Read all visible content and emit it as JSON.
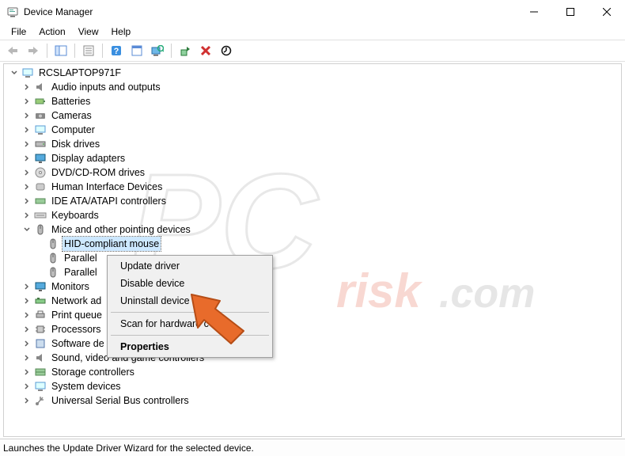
{
  "window": {
    "title": "Device Manager"
  },
  "menus": {
    "file": "File",
    "action": "Action",
    "view": "View",
    "help": "Help"
  },
  "tree": {
    "root": "RCSLAPTOP971F",
    "items": [
      "Audio inputs and outputs",
      "Batteries",
      "Cameras",
      "Computer",
      "Disk drives",
      "Display adapters",
      "DVD/CD-ROM drives",
      "Human Interface Devices",
      "IDE ATA/ATAPI controllers",
      "Keyboards",
      "Mice and other pointing devices",
      "Monitors",
      "Network adapters",
      "Print queues",
      "Processors",
      "Software devices",
      "Sound, video and game controllers",
      "Storage controllers",
      "System devices",
      "Universal Serial Bus controllers"
    ],
    "mice_children": [
      "HID-compliant mouse",
      "Parallels Mouse Synchronization Device",
      "Parallels USB Mouse Synchronization Device"
    ],
    "mice_children_cut": [
      "HID-compliant mouse",
      "Parallel",
      "Parallel"
    ],
    "items_cut": {
      "12": "Network ad",
      "13": "Print queue",
      "14": "Processors",
      "15": "Software de"
    }
  },
  "context_menu": {
    "update": "Update driver",
    "disable": "Disable device",
    "uninstall": "Uninstall device",
    "scan": "Scan for hardware changes",
    "scan_cut": "Scan for hardware c",
    "properties": "Properties"
  },
  "status": "Launches the Update Driver Wizard for the selected device.",
  "watermark": "PCrisk.com"
}
